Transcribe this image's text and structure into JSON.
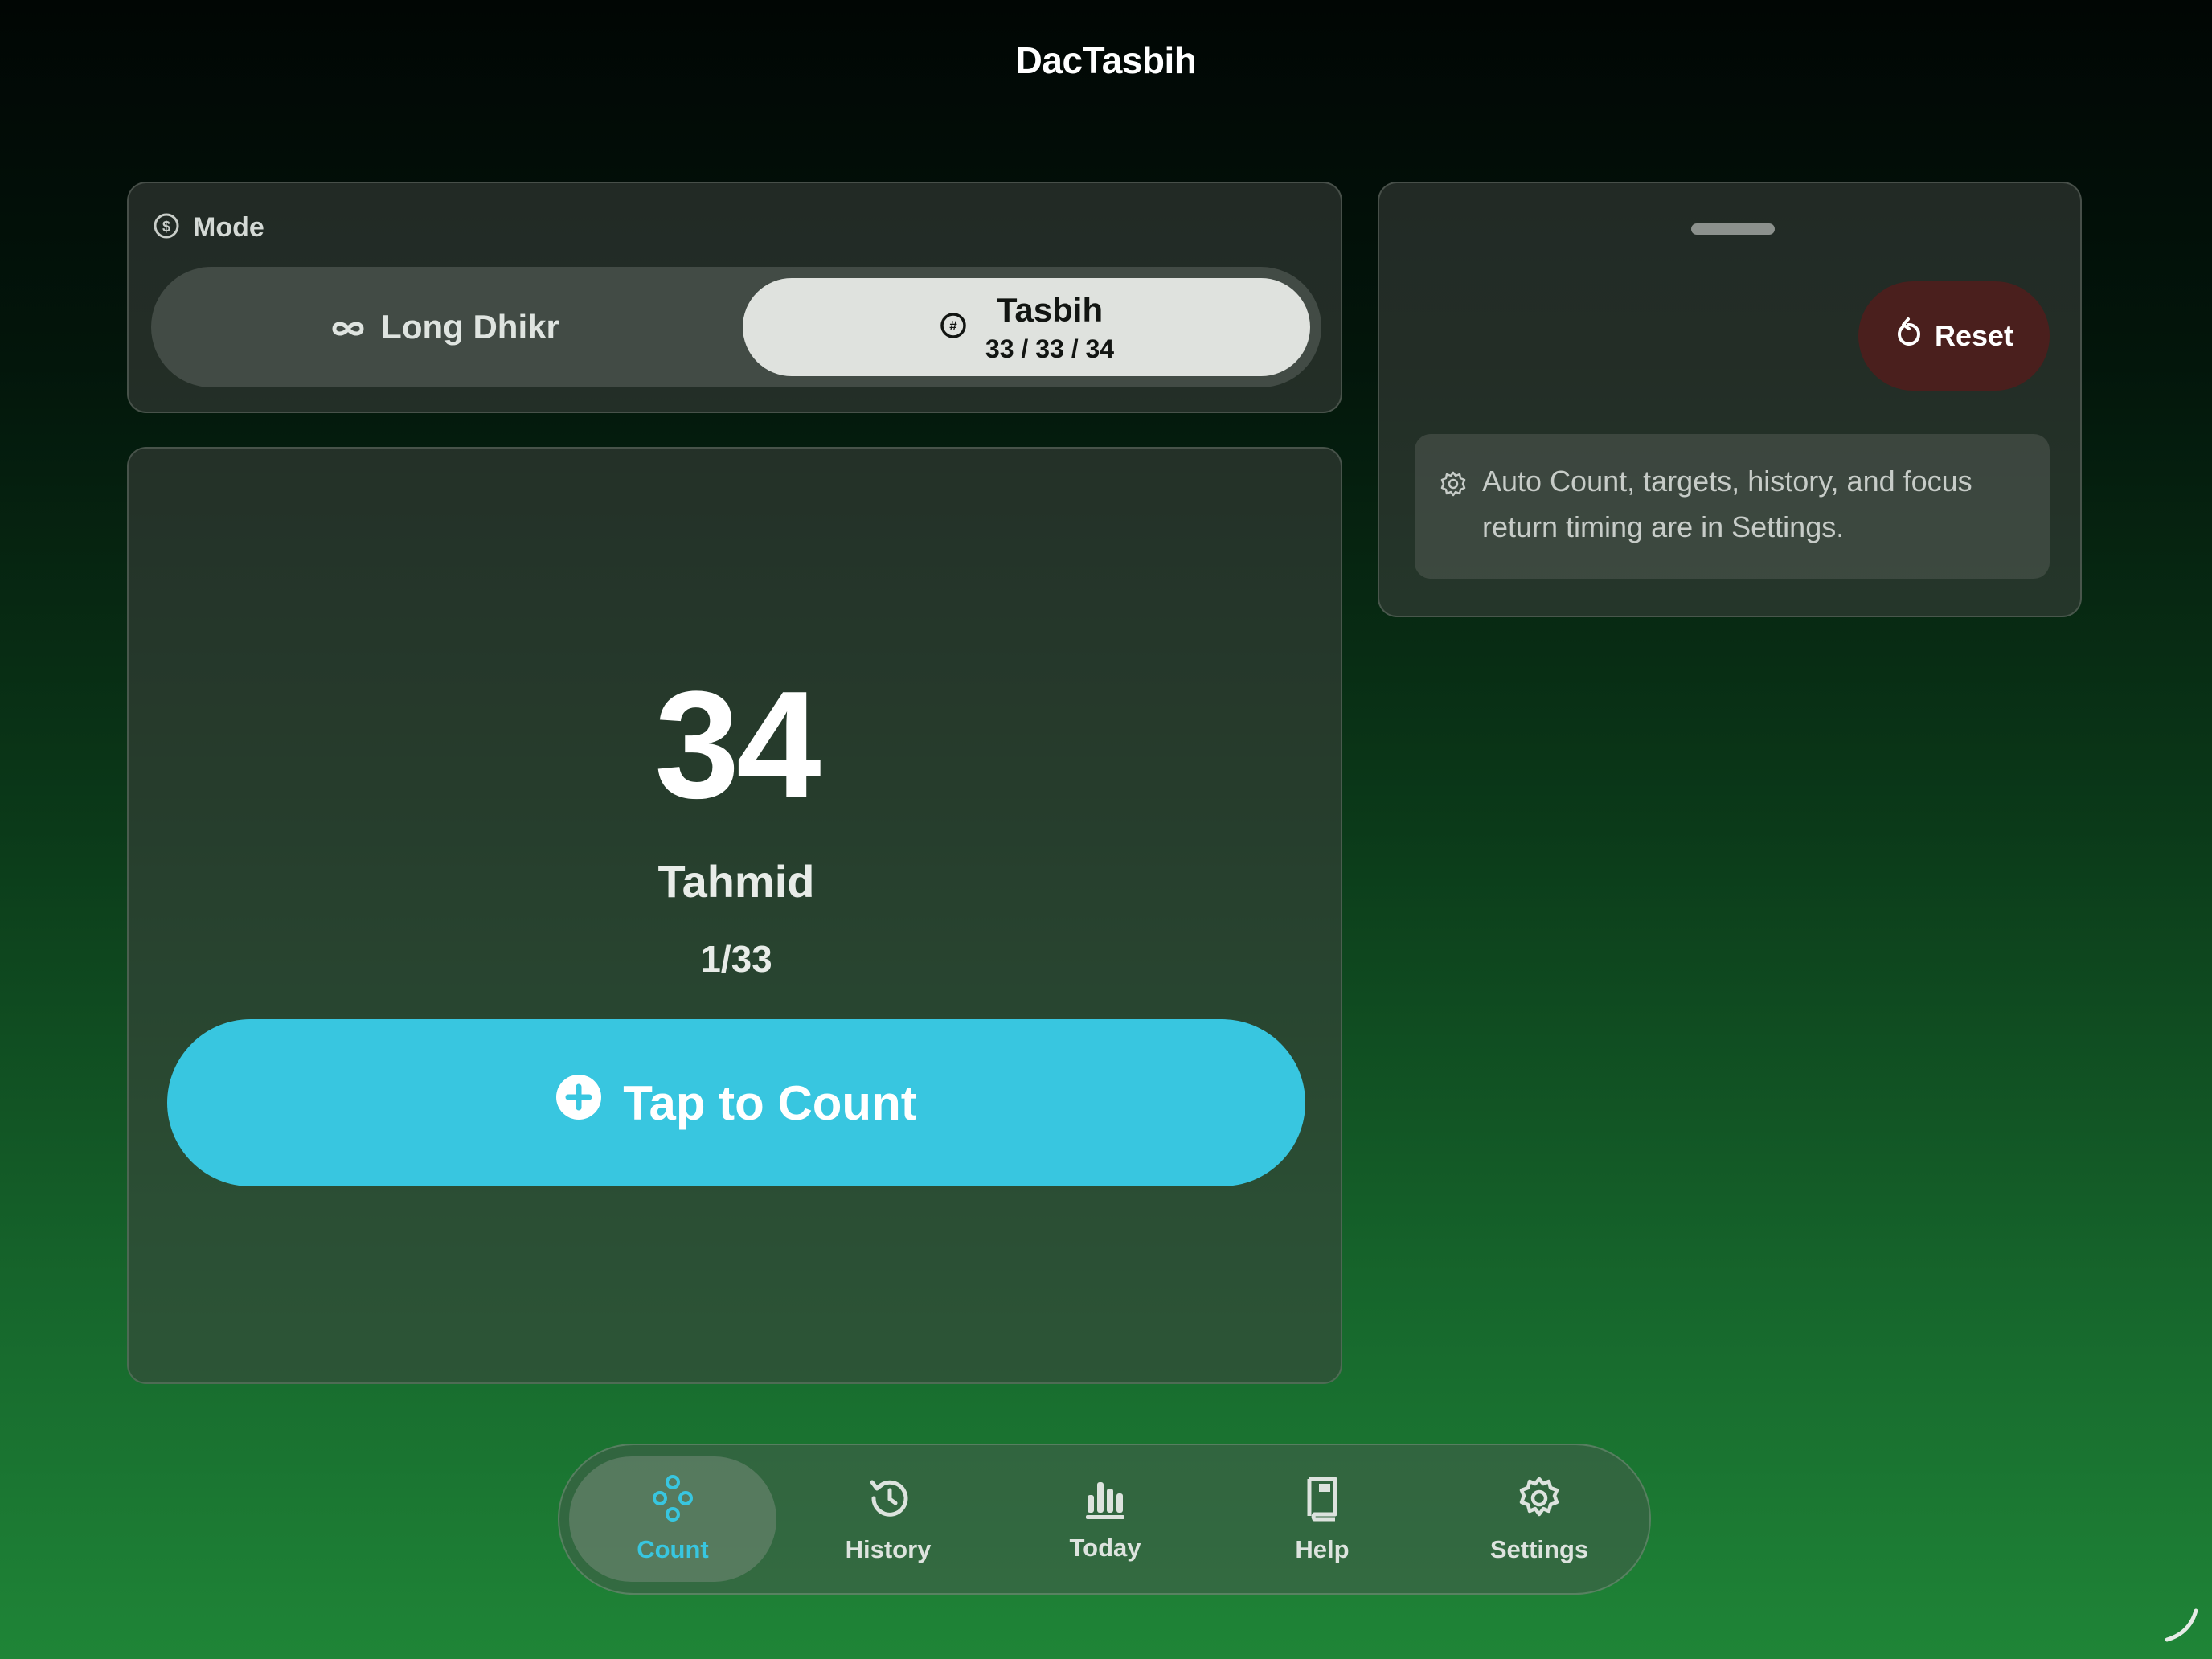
{
  "app": {
    "title": "DacTasbih"
  },
  "mode": {
    "label": "Mode",
    "options": [
      {
        "label": "Long Dhikr",
        "icon": "infinity-icon",
        "selected": false
      },
      {
        "label": "Tasbih",
        "sublabel": "33 / 33 / 34",
        "icon": "hash-circle-icon",
        "selected": true
      }
    ]
  },
  "counter": {
    "count": "34",
    "dhikr_name": "Tahmid",
    "progress": "1/33",
    "tap_label": "Tap to Count"
  },
  "side_panel": {
    "reset_label": "Reset",
    "info_text": "Auto Count, targets, history, and focus return timing are in Settings."
  },
  "nav": {
    "items": [
      {
        "label": "Count",
        "icon": "count-icon",
        "active": true
      },
      {
        "label": "History",
        "icon": "history-icon",
        "active": false
      },
      {
        "label": "Today",
        "icon": "bar-chart-icon",
        "active": false
      },
      {
        "label": "Help",
        "icon": "book-icon",
        "active": false
      },
      {
        "label": "Settings",
        "icon": "gear-icon",
        "active": false
      }
    ]
  },
  "colors": {
    "accent": "#38c6e0",
    "reset_bg": "#4a1f1d",
    "selected_segment": "#dfe2de"
  }
}
